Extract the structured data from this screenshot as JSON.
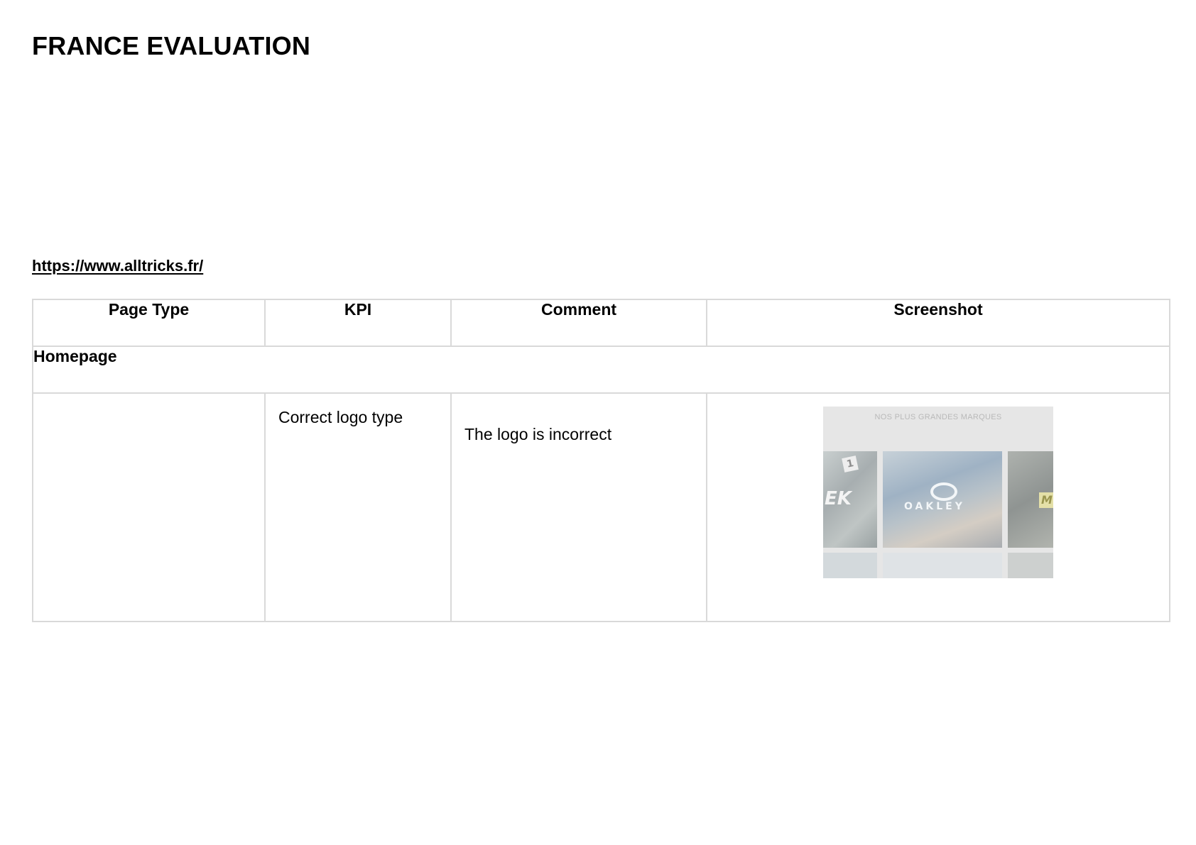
{
  "document": {
    "title": "FRANCE EVALUATION",
    "url": "https://www.alltricks.fr/"
  },
  "table": {
    "headers": [
      "Page Type",
      "KPI",
      "Comment",
      "Screenshot"
    ],
    "section": "Homepage",
    "rows": [
      {
        "page_type": "",
        "kpi": "Correct logo type",
        "comment": "The logo is incorrect",
        "screenshot": {
          "heading": "NOS PLUS GRANDES MARQUES",
          "tile_marks": [
            "EK",
            "1",
            "OAKLEY",
            "M"
          ]
        }
      }
    ]
  },
  "colors": {
    "border": "#d9d9d9",
    "text": "#000000",
    "screenshot_bg": "#e6e6e6"
  }
}
